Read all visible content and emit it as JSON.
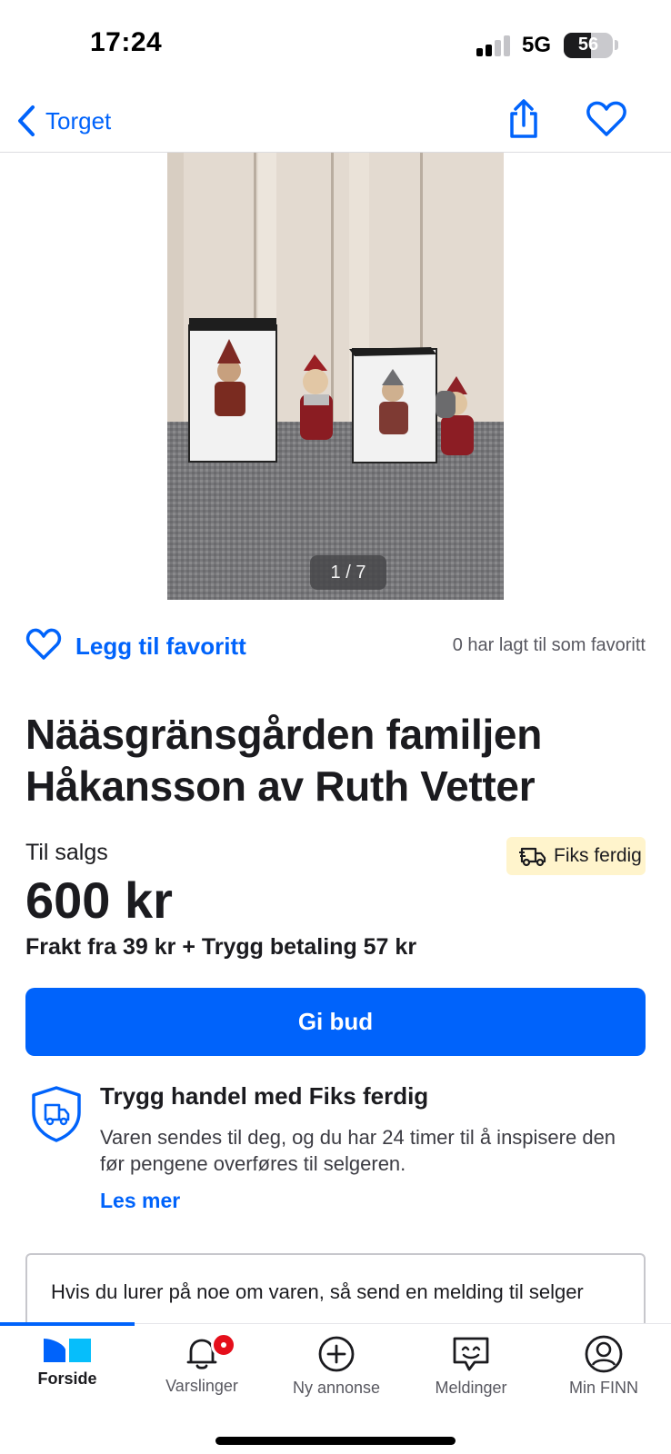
{
  "status_bar": {
    "time": "17:24",
    "network": "5G",
    "battery": "56"
  },
  "nav": {
    "back_label": "Torget",
    "icons": {
      "back": "chevron-left-icon",
      "share": "share-icon",
      "favorite": "heart-icon"
    }
  },
  "gallery": {
    "counter": "1 / 7"
  },
  "favorite": {
    "label": "Legg til favoritt",
    "count_text": "0 har lagt til som favoritt"
  },
  "listing": {
    "title": "Nääsgränsgården familjen Håkansson av Ruth Vetter",
    "status": "Til salgs",
    "badge": "Fiks ferdig",
    "price": "600 kr",
    "shipping": "Frakt fra 39 kr + Trygg betaling 57 kr",
    "bid_button": "Gi bud"
  },
  "safe_trade": {
    "title": "Trygg handel med Fiks ferdig",
    "description": "Varen sendes til deg, og du har 24 timer til å inspisere den før pengene overføres til selgeren.",
    "link": "Les mer"
  },
  "message": {
    "placeholder": "Hvis du lurer på noe om varen, så send en melding til selger"
  },
  "tabs": [
    {
      "label": "Forside",
      "icon": "home-icon",
      "active": true
    },
    {
      "label": "Varslinger",
      "icon": "bell-icon",
      "active": false
    },
    {
      "label": "Ny annonse",
      "icon": "plus-circle-icon",
      "active": false
    },
    {
      "label": "Meldinger",
      "icon": "chat-icon",
      "active": false
    },
    {
      "label": "Min FINN",
      "icon": "profile-icon",
      "active": false
    }
  ],
  "colors": {
    "accent": "#0063fb",
    "badge_bg": "#fff4cc",
    "notification": "#e50f1b"
  }
}
